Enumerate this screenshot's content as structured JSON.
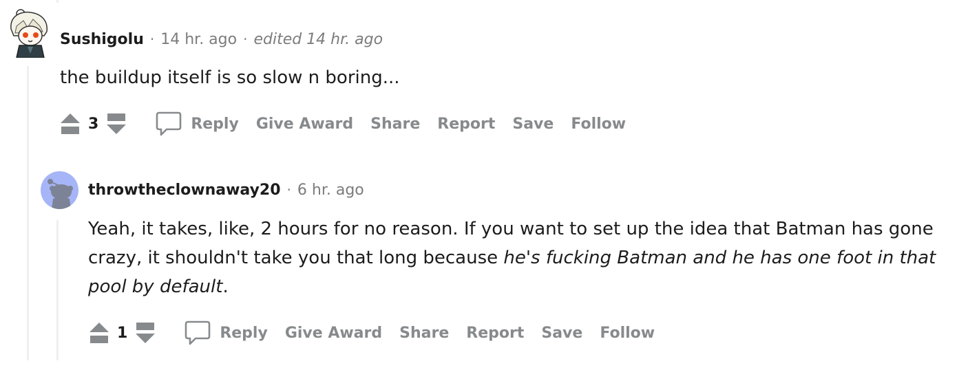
{
  "comments": [
    {
      "username": "Sushigolu",
      "time": "14 hr. ago",
      "edited": "edited 14 hr. ago",
      "body": "the buildup itself is so slow n boring...",
      "score": "3",
      "actions": {
        "reply": "Reply",
        "award": "Give Award",
        "share": "Share",
        "report": "Report",
        "save": "Save",
        "follow": "Follow"
      }
    },
    {
      "username": "throwtheclownaway20",
      "time": "6 hr. ago",
      "body_plain": "Yeah, it takes, like, 2 hours for no reason. If you want to set up the idea that Batman has gone crazy, it shouldn't take you that long because ",
      "body_italic": "he's fucking Batman and he has one foot in that pool by default",
      "body_end": ".",
      "score": "1",
      "actions": {
        "reply": "Reply",
        "award": "Give Award",
        "share": "Share",
        "report": "Report",
        "save": "Save",
        "follow": "Follow"
      }
    }
  ],
  "colors": {
    "thread_line": "#edeff1",
    "meta": "#7c7c7c",
    "action": "#878a8c",
    "avatar_bg": "#a6b5f7",
    "snoo": "#7d8396"
  }
}
